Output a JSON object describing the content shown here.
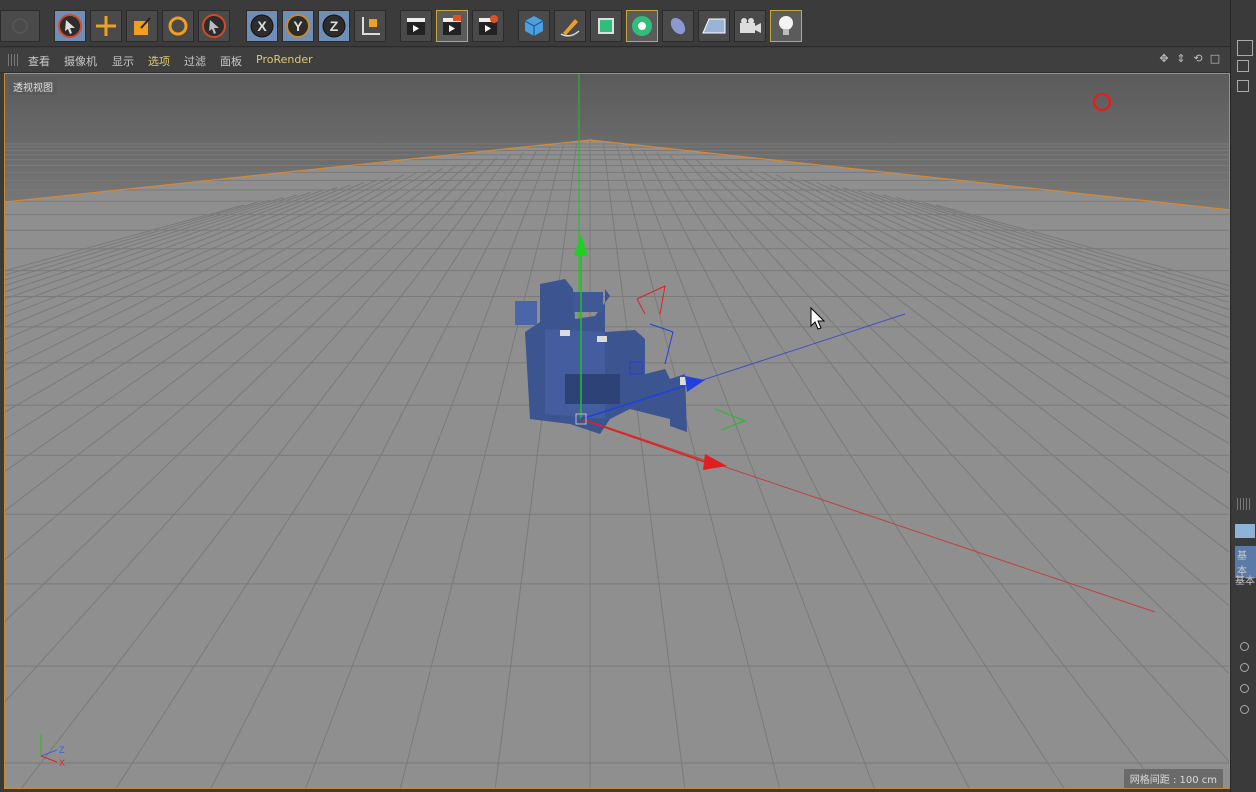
{
  "toolbar": {
    "buttons": [
      "undo",
      "select",
      "move",
      "scale",
      "rotate",
      "live-select",
      "x-axis",
      "y-axis",
      "z-axis",
      "world-coord",
      "render-view",
      "render-picture",
      "render-settings",
      "cube",
      "pen",
      "subdivide",
      "cloner",
      "deformer",
      "floor",
      "camera",
      "light"
    ],
    "axis_x": "X",
    "axis_y": "Y",
    "axis_z": "Z"
  },
  "viewport_menu": {
    "items": [
      "查看",
      "摄像机",
      "显示",
      "选项",
      "过滤",
      "面板",
      "ProRender"
    ],
    "selected": "选项"
  },
  "viewport": {
    "label": "透视视图",
    "grid_readout": "网格间距 : 100 cm",
    "axis_labels": {
      "z": "Z",
      "x": "X"
    }
  },
  "right_panel": {
    "tab1": "基本",
    "tab2": "基本"
  },
  "colors": {
    "accent_orange": "#c88a2e",
    "axis_x": "#e02020",
    "axis_y": "#20c020",
    "axis_z": "#2040e0",
    "object": "#3c5490"
  }
}
